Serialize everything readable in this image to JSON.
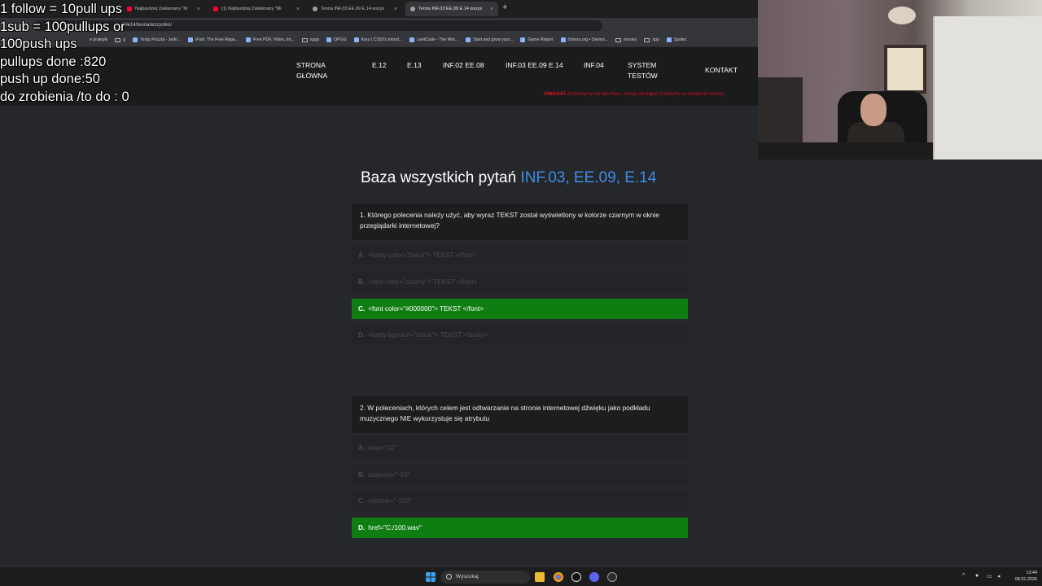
{
  "overlay": {
    "lines": [
      "1 follow = 10pull ups",
      "1sub = 100pullups or",
      "100push ups",
      "pullups done :820",
      "push up done:50",
      "do zrobienia /to do : 0"
    ]
  },
  "browser": {
    "tabs": [
      {
        "label": "Najbardziej Zakłamany \"M"
      },
      {
        "label": "(1) Najbardziej Zakłamany \"Mi"
      },
      {
        "label": "Teoria INF.03 EE.09 E.14 wszys"
      },
      {
        "label": "Teoria INF.03 EE.09 E.14 wszys"
      }
    ],
    "address_fragment": "09e14/teoria/wszystko/",
    "bookmarks": [
      "e praktyki",
      "g",
      "Temp Poczta - Jedn...",
      "iFixit: The Free Repa...",
      "Free PDF, Video, Im...",
      "xppp",
      "OPGG",
      "Kurs | CS50's Introd...",
      "LeetCode - The Wor...",
      "Start and grow your...",
      "Game Report",
      "lichess.org • Darmo...",
      "movies",
      "xpp",
      "Społec"
    ]
  },
  "nav": {
    "home_line1": "STRONA",
    "home_line2": "GŁÓWNA",
    "e12": "E.12",
    "e13": "E.13",
    "inf02": "INF.02 EE.08",
    "inf03": "INF.03 EE.09 E.14",
    "inf04": "INF.04",
    "tests_line1": "SYSTEM",
    "tests_line2": "TESTÓW",
    "contact": "KONTAKT",
    "warning_bold": "UWAGA!",
    "warning_text": "Zmieniamy się dla Was, mogą wystąpić problemy w działaniu strony."
  },
  "page": {
    "title_plain": "Baza wszystkich pytań",
    "title_accent": "INF.03, EE.09, E.14"
  },
  "questions": [
    {
      "text": "1. Którego polecenia należy użyć, aby wyraz TEKST został wyświetlony w kolorze czarnym w oknie przeglądarki internetowej?",
      "answers": [
        {
          "letter": "A.",
          "text": "<body color=\"black\"> TEKST </font>",
          "correct": false
        },
        {
          "letter": "B.",
          "text": "<font color=\"czarny\"> TEKST </font>",
          "correct": false
        },
        {
          "letter": "C.",
          "text": "<font color=\"#000000\"> TEKST </font>",
          "correct": true
        },
        {
          "letter": "D.",
          "text": "<body bgcolor=\"black\"> TEKST </body>",
          "correct": false
        }
      ]
    },
    {
      "text": "2. W poleceniach, których celem jest odtwarzanie na stronie internetowej dźwięku jako podkładu muzycznego NIE wykorzystuje się atrybutu",
      "answers": [
        {
          "letter": "A.",
          "text": "loop=\"10\"",
          "correct": false
        },
        {
          "letter": "B.",
          "text": "balance=\"-10\"",
          "correct": false
        },
        {
          "letter": "C.",
          "text": "volume=\"-100\"",
          "correct": false
        },
        {
          "letter": "D.",
          "text": "href=\"C:/100.wav\"",
          "correct": true
        }
      ]
    }
  ],
  "taskbar": {
    "search_placeholder": "Wyszukaj",
    "time": "13:44",
    "date": "08.01.2026"
  },
  "colors": {
    "correct": "#0f7e12",
    "accent": "#3d8ee6",
    "warning": "#c8101a"
  }
}
